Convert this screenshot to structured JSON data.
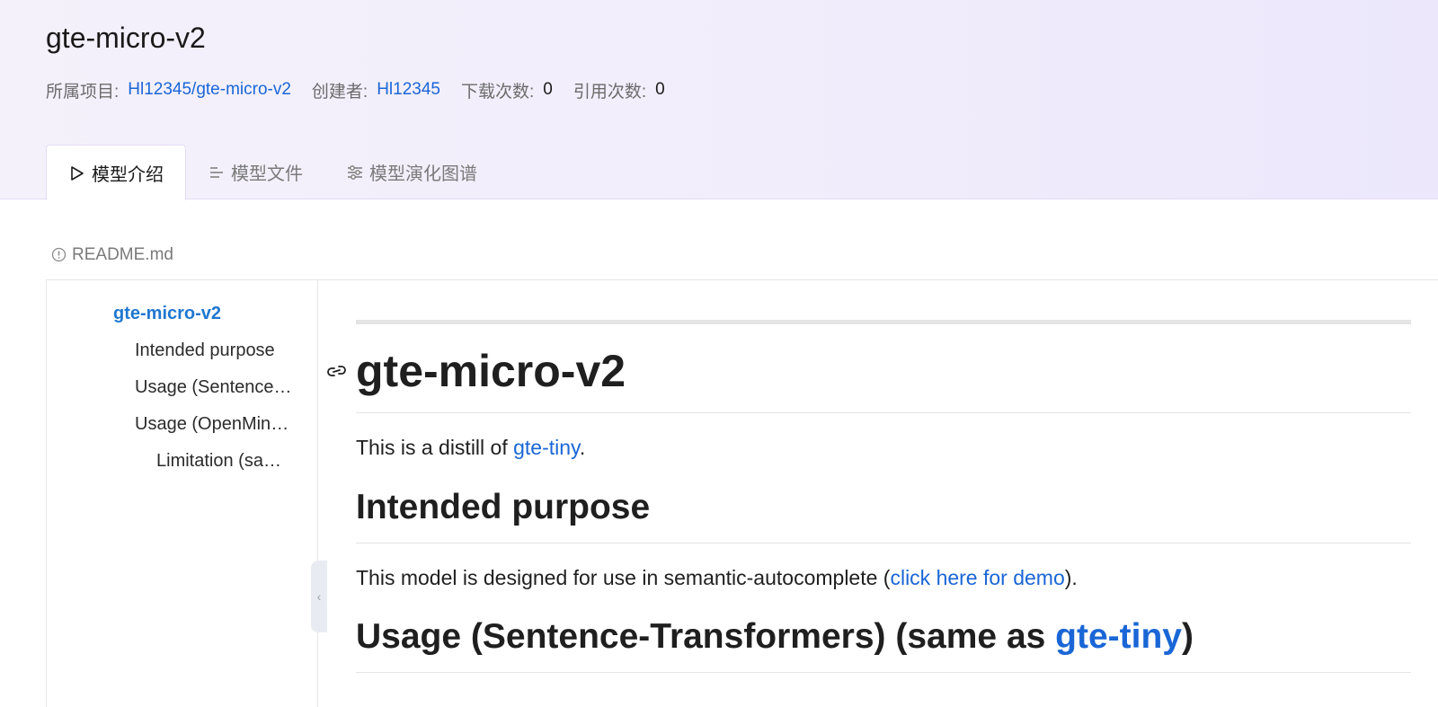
{
  "header": {
    "title": "gte-micro-v2",
    "meta": {
      "project_label": "所属项目:",
      "project_value": "Hl12345/gte-micro-v2",
      "creator_label": "创建者:",
      "creator_value": "Hl12345",
      "downloads_label": "下载次数:",
      "downloads_value": "0",
      "citations_label": "引用次数:",
      "citations_value": "0"
    },
    "tabs": [
      {
        "label": "模型介绍",
        "icon": "play-triangle-icon",
        "active": true
      },
      {
        "label": "模型文件",
        "icon": "file-lines-icon",
        "active": false
      },
      {
        "label": "模型演化图谱",
        "icon": "sliders-icon",
        "active": false
      }
    ]
  },
  "readme": {
    "label": "README.md",
    "icon": "info-circle-icon"
  },
  "toc": {
    "items": [
      {
        "label": "gte-micro-v2",
        "level": 0
      },
      {
        "label": "Intended purpose",
        "level": 1
      },
      {
        "label": "Usage (Sentence-Transformers) (same as gte-tiny)",
        "level": 1
      },
      {
        "label": "Usage (OpenMindS...)",
        "level": 1
      },
      {
        "label": "Limitation (same as ...)",
        "level": 2
      }
    ]
  },
  "content": {
    "h1": "gte-micro-v2",
    "intro_prefix": "This is a distill of ",
    "intro_link": "gte-tiny",
    "intro_suffix": ".",
    "h2_purpose": "Intended purpose",
    "purpose_prefix": "This model is designed for use in semantic-autocomplete (",
    "purpose_link": "click here for demo",
    "purpose_suffix": ").",
    "h2_usage_prefix": "Usage (Sentence-Transformers) (same as ",
    "h2_usage_link": "gte-tiny",
    "h2_usage_suffix": ")"
  },
  "colors": {
    "link": "#1a66d6",
    "toc_active": "#1f77d0",
    "header_bg": "#f1edfb"
  }
}
